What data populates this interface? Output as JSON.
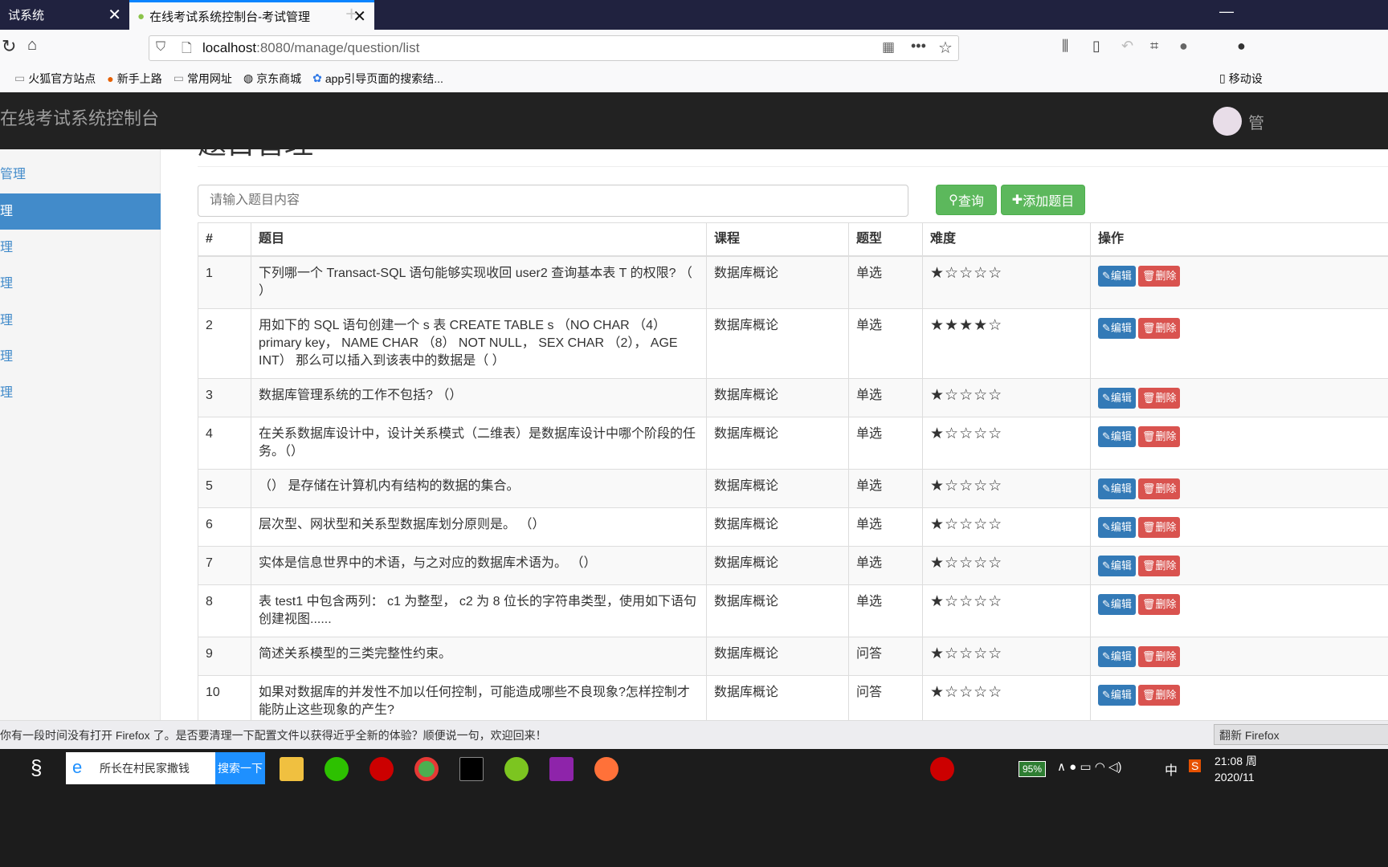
{
  "browser": {
    "tab1_title": "试系统",
    "tab2_title": "在线考试系统控制台-考试管理",
    "url_host": "localhost",
    "url_path": ":8080/manage/question/list",
    "bookmarks": [
      "火狐官方站点",
      "新手上路",
      "常用网址",
      "京东商城",
      "app引导页面的搜索结..."
    ],
    "mobile_bookmark": "移动设"
  },
  "app": {
    "brand": "在线考试系统控制台",
    "user": "管",
    "page_title": "题目管理",
    "sidebar": [
      {
        "label": "管理",
        "active": false
      },
      {
        "label": "理",
        "active": true
      },
      {
        "label": "理",
        "active": false
      },
      {
        "label": "理",
        "active": false
      },
      {
        "label": "理",
        "active": false
      },
      {
        "label": "理",
        "active": false
      },
      {
        "label": "理",
        "active": false
      }
    ],
    "search_placeholder": "请输入题目内容",
    "query_btn": "查询",
    "add_btn": "添加题目",
    "columns": [
      "#",
      "题目",
      "课程",
      "题型",
      "难度",
      "操作"
    ],
    "edit_label": "编辑",
    "delete_label": "删除",
    "rows": [
      {
        "id": "1",
        "question": "下列哪一个 Transact-SQL 语句能够实现收回 user2 查询基本表 T 的权限? （ ）",
        "course": "数据库概论",
        "type": "单选",
        "difficulty": 1,
        "stars": "★☆☆☆☆"
      },
      {
        "id": "2",
        "question": "用如下的 SQL 语句创建一个 s 表 CREATE TABLE s （NO CHAR （4） primary key， NAME CHAR （8） NOT NULL， SEX CHAR （2）， AGE INT） 那么可以插入到该表中的数据是（ ）",
        "course": "数据库概论",
        "type": "单选",
        "difficulty": 4,
        "stars": "★★★★☆"
      },
      {
        "id": "3",
        "question": "数据库管理系统的工作不包括? （）",
        "course": "数据库概论",
        "type": "单选",
        "difficulty": 1,
        "stars": "★☆☆☆☆"
      },
      {
        "id": "4",
        "question": "在关系数据库设计中，设计关系模式（二维表）是数据库设计中哪个阶段的任务。（）",
        "course": "数据库概论",
        "type": "单选",
        "difficulty": 1,
        "stars": "★☆☆☆☆"
      },
      {
        "id": "5",
        "question": "（） 是存储在计算机内有结构的数据的集合。",
        "course": "数据库概论",
        "type": "单选",
        "difficulty": 1,
        "stars": "★☆☆☆☆"
      },
      {
        "id": "6",
        "question": "层次型、网状型和关系型数据库划分原则是。 （）",
        "course": "数据库概论",
        "type": "单选",
        "difficulty": 1,
        "stars": "★☆☆☆☆"
      },
      {
        "id": "7",
        "question": "实体是信息世界中的术语，与之对应的数据库术语为。 （）",
        "course": "数据库概论",
        "type": "单选",
        "difficulty": 1,
        "stars": "★☆☆☆☆"
      },
      {
        "id": "8",
        "question": "表 test1 中包含两列： c1 为整型， c2 为 8 位长的字符串类型，使用如下语句创建视图......",
        "course": "数据库概论",
        "type": "单选",
        "difficulty": 1,
        "stars": "★☆☆☆☆"
      },
      {
        "id": "9",
        "question": "简述关系模型的三类完整性约束。",
        "course": "数据库概论",
        "type": "问答",
        "difficulty": 1,
        "stars": "★☆☆☆☆"
      },
      {
        "id": "10",
        "question": "如果对数据库的并发性不加以任何控制，可能造成哪些不良现象?怎样控制才能防止这些现象的产生?",
        "course": "数据库概论",
        "type": "问答",
        "difficulty": 1,
        "stars": "★☆☆☆☆"
      }
    ]
  },
  "notification": {
    "text": "你有一段时间没有打开 Firefox 了。是否要清理一下配置文件以获得近乎全新的体验？顺便说一句，欢迎回来！",
    "button": "翻新 Firefox"
  },
  "taskbar": {
    "search_text": "所长在村民家撒钱",
    "search_btn": "搜索一下",
    "battery": "95%",
    "ime": "中",
    "time": "21:08 周",
    "date": "2020/11"
  }
}
